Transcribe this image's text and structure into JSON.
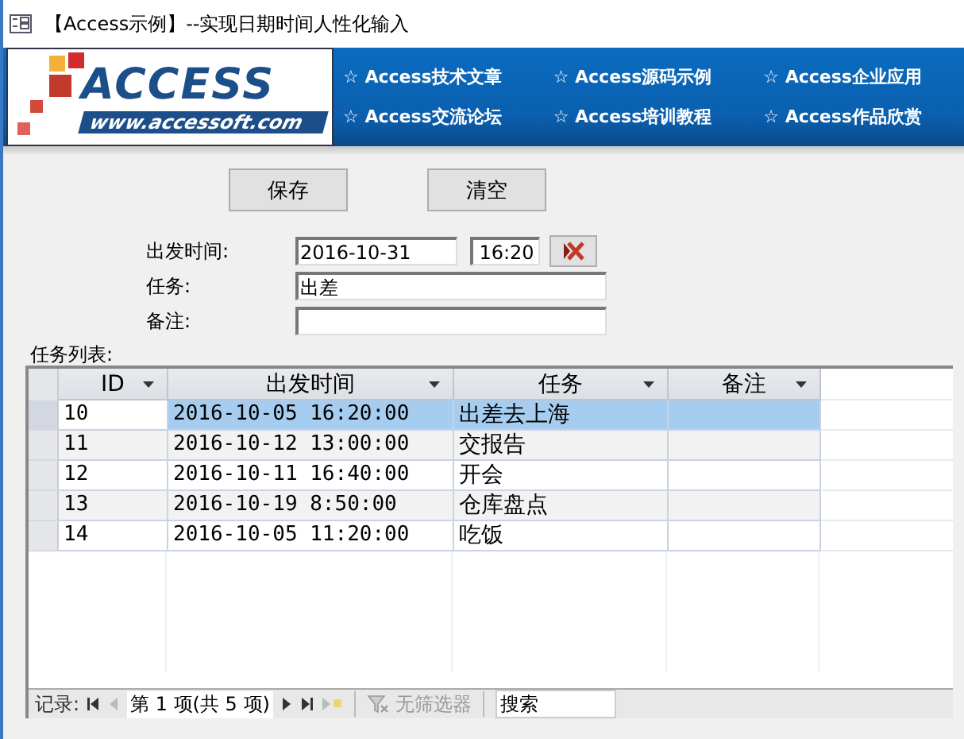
{
  "window": {
    "title": "【Access示例】--实现日期时间人性化输入"
  },
  "banner": {
    "logo_title": "ACCESS",
    "logo_url": "www.accessoft.com",
    "links": [
      {
        "label": "☆ Access技术文章"
      },
      {
        "label": "☆ Access源码示例"
      },
      {
        "label": "☆ Access企业应用"
      },
      {
        "label": "☆ Access交流论坛"
      },
      {
        "label": "☆ Access培训教程"
      },
      {
        "label": "☆ Access作品欣赏"
      }
    ]
  },
  "buttons": [
    {
      "label": "保存"
    },
    {
      "label": "清空"
    }
  ],
  "form": {
    "departure_label": "出发时间:",
    "date": "2016-10-31",
    "time": "16:20",
    "task_label": "任务:",
    "task": "出差",
    "note_label": "备注:"
  },
  "table": {
    "title": "任务列表:",
    "columns": [
      "ID",
      "出发时间",
      "任务",
      "备注"
    ],
    "rows": [
      {
        "id": "10",
        "time": "2016-10-05 16:20:00",
        "task": "出差去上海",
        "selected": true
      },
      {
        "id": "11",
        "time": "2016-10-12 13:00:00",
        "task": "交报告",
        "selected": false
      },
      {
        "id": "12",
        "time": "2016-10-11 16:40:00",
        "task": "开会",
        "selected": false
      },
      {
        "id": "13",
        "time": "2016-10-19 8:50:00",
        "task": "仓库盘点",
        "selected": false
      },
      {
        "id": "14",
        "time": "2016-10-05 11:20:00",
        "task": "吃饭",
        "selected": false
      }
    ]
  },
  "navigator": {
    "label": "记录:",
    "position": "第 1 项(共 5 项)",
    "filter": "无筛选器",
    "search_placeholder": "搜索"
  }
}
